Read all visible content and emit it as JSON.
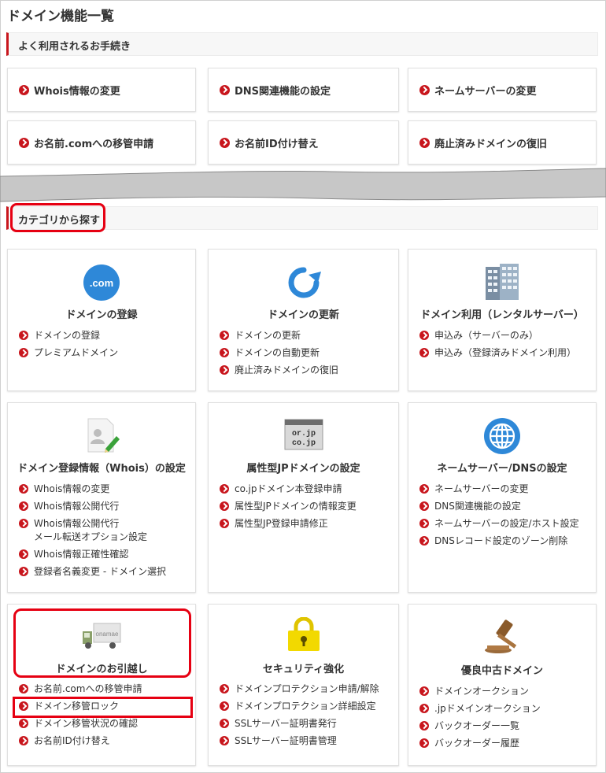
{
  "page": {
    "title": "ドメイン機能一覧"
  },
  "quick": {
    "heading": "よく利用されるお手続き",
    "items": [
      {
        "label": "Whois情報の変更"
      },
      {
        "label": "DNS関連機能の設定"
      },
      {
        "label": "ネームサーバーの変更"
      },
      {
        "label": "お名前.comへの移管申請"
      },
      {
        "label": "お名前ID付け替え"
      },
      {
        "label": "廃止済みドメインの復旧"
      }
    ]
  },
  "category": {
    "heading": "カテゴリから探す",
    "cards": [
      {
        "title": "ドメインの登録",
        "icon_text": ".com",
        "links": [
          "ドメインの登録",
          "プレミアムドメイン"
        ]
      },
      {
        "title": "ドメインの更新",
        "links": [
          "ドメインの更新",
          "ドメインの自動更新",
          "廃止済みドメインの復旧"
        ]
      },
      {
        "title": "ドメイン利用（レンタルサーバー）",
        "links": [
          "申込み（サーバーのみ）",
          "申込み（登録済みドメイン利用）"
        ]
      },
      {
        "title": "ドメイン登録情報（Whois）の設定",
        "links": [
          "Whois情報の変更",
          "Whois情報公開代行",
          "Whois情報公開代行",
          "Whois情報正確性確認",
          "登録者名義変更 - ドメイン選択"
        ],
        "sub_line": "メール転送オプション設定"
      },
      {
        "title": "属性型JPドメインの設定",
        "icon_text": [
          "or.jp",
          "co.jp"
        ],
        "links": [
          "co.jpドメイン本登録申請",
          "属性型JPドメインの情報変更",
          "属性型JP登録申請修正"
        ]
      },
      {
        "title": "ネームサーバー/DNSの設定",
        "links": [
          "ネームサーバーの変更",
          "DNS関連機能の設定",
          "ネームサーバーの設定/ホスト設定",
          "DNSレコード設定のゾーン削除"
        ]
      },
      {
        "title": "ドメインのお引越し",
        "icon_text": "onamae",
        "links": [
          "お名前.comへの移管申請",
          "ドメイン移管ロック",
          "ドメイン移管状況の確認",
          "お名前ID付け替え"
        ]
      },
      {
        "title": "セキュリティ強化",
        "links": [
          "ドメインプロテクション申請/解除",
          "ドメインプロテクション詳細設定",
          "SSLサーバー証明書発行",
          "SSLサーバー証明書管理"
        ]
      },
      {
        "title": "優良中古ドメイン",
        "links": [
          "ドメインオークション",
          ".jpドメインオークション",
          "バックオーダー一覧",
          "バックオーダー履歴"
        ]
      }
    ]
  },
  "colors": {
    "accent": "#c8161d",
    "highlight": "#e60012",
    "icon_blue": "#2e88d8"
  }
}
